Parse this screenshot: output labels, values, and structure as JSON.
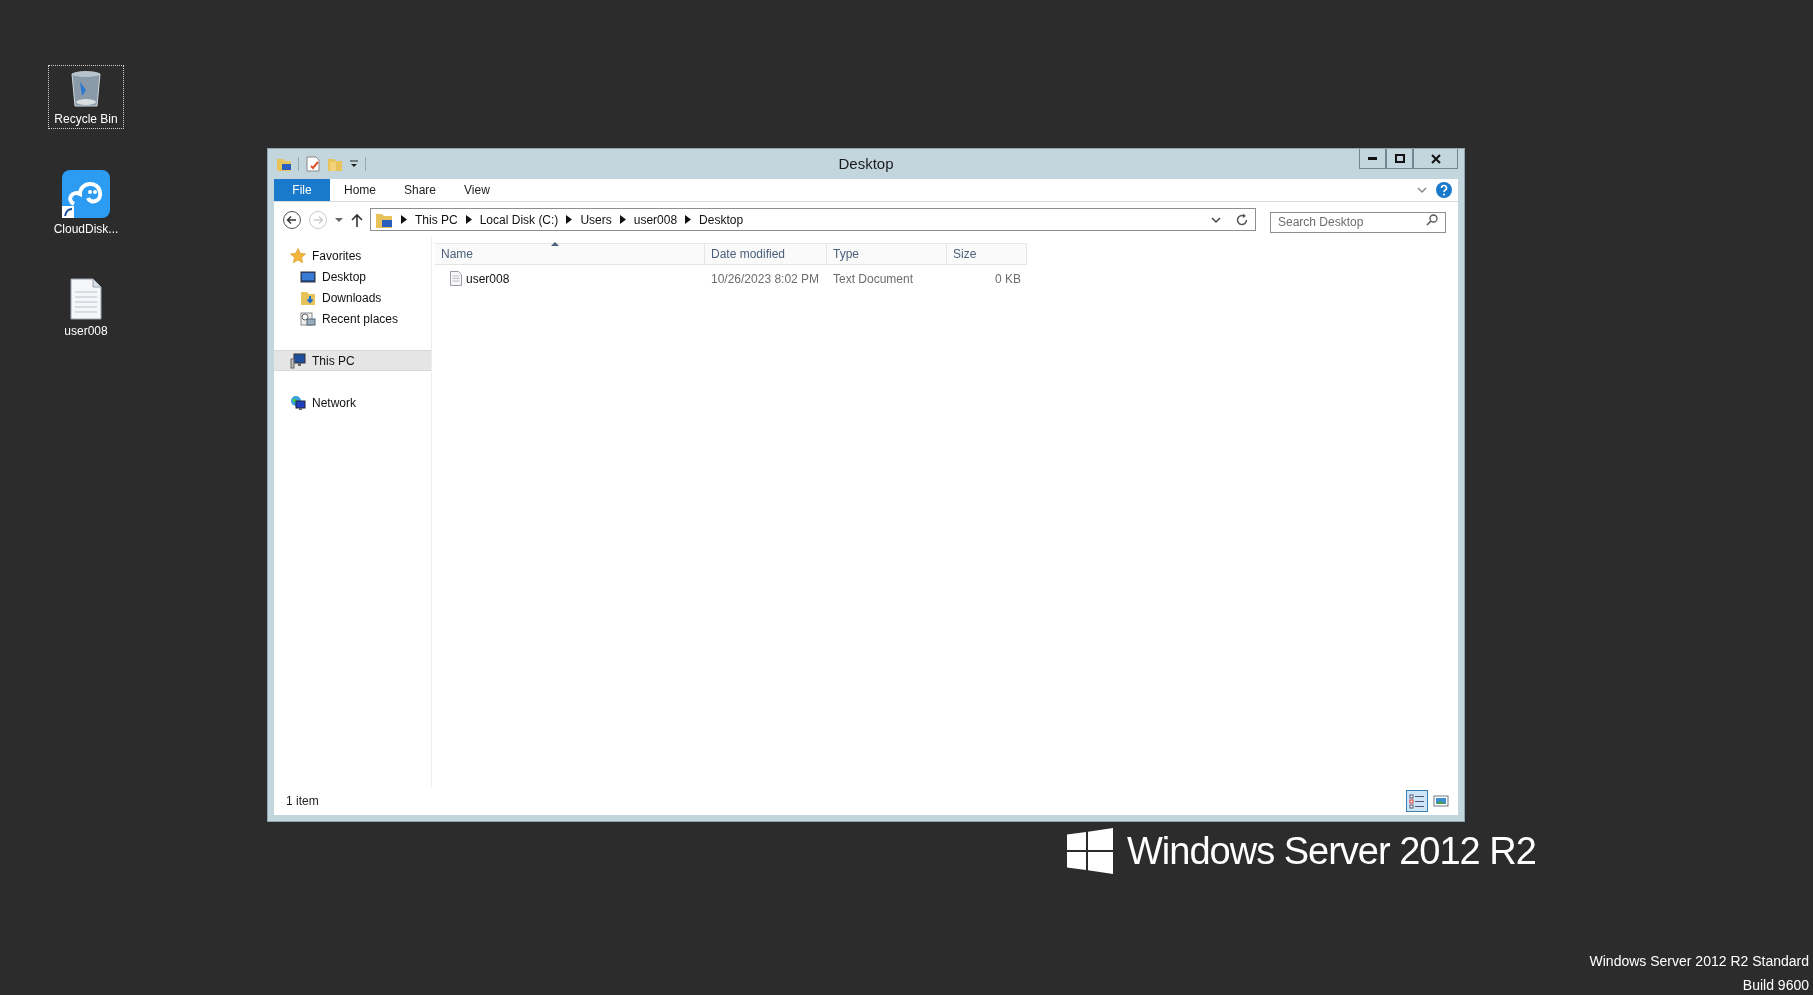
{
  "desktop_icons": [
    {
      "label": "Recycle Bin",
      "kind": "recycle",
      "selected": true
    },
    {
      "label": "CloudDisk...",
      "kind": "app",
      "selected": false
    },
    {
      "label": "user008",
      "kind": "textfile",
      "selected": false
    }
  ],
  "window": {
    "title": "Desktop"
  },
  "ribbon_tabs": [
    {
      "label": "File",
      "kind": "file"
    },
    {
      "label": "Home",
      "kind": "tab"
    },
    {
      "label": "Share",
      "kind": "tab"
    },
    {
      "label": "View",
      "kind": "tab"
    }
  ],
  "address": {
    "segments": [
      "This PC",
      "Local Disk (C:)",
      "Users",
      "user008",
      "Desktop"
    ]
  },
  "search": {
    "placeholder": "Search Desktop"
  },
  "nav": [
    {
      "label": "Favorites",
      "kind": "favorites",
      "selected": false,
      "children": [
        {
          "label": "Desktop",
          "kind": "desktop",
          "selected": false
        },
        {
          "label": "Downloads",
          "kind": "downloads",
          "selected": false
        },
        {
          "label": "Recent places",
          "kind": "recent",
          "selected": false
        }
      ]
    },
    {
      "label": "This PC",
      "kind": "pc",
      "selected": true
    },
    {
      "label": "Network",
      "kind": "network",
      "selected": false
    }
  ],
  "table": {
    "columns": [
      {
        "label": "Name",
        "sorted": true
      },
      {
        "label": "Date modified",
        "sorted": false
      },
      {
        "label": "Type",
        "sorted": false
      },
      {
        "label": "Size",
        "sorted": false
      }
    ],
    "rows": [
      {
        "selected": false,
        "cells": [
          "user008",
          "10/26/2023 8:02 PM",
          "Text Document",
          "0 KB"
        ]
      }
    ]
  },
  "status_bar": {
    "text": "1 item",
    "views": [
      {
        "kind": "details",
        "selected": true
      },
      {
        "kind": "tiles",
        "selected": false
      }
    ]
  },
  "branding": {
    "logo_text": "Windows Server 2012 R2",
    "edition": "Windows Server 2012 R2 Standard",
    "build": "Build 9600"
  }
}
